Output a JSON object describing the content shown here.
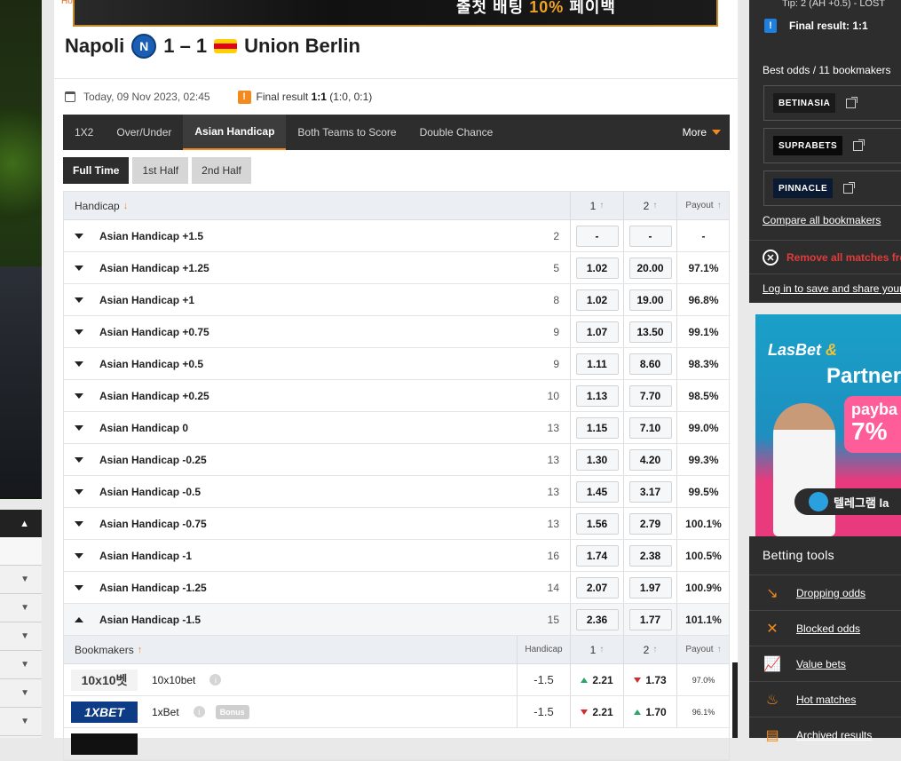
{
  "left_panel": {
    "rows": 6
  },
  "banner": {
    "text": "출첫 배팅",
    "highlight": "10%",
    "suffix": "페이백",
    "breadcrumb": "Ho"
  },
  "match": {
    "home": "Napoli",
    "home_crest": "N",
    "score": "1 – 1",
    "away": "Union Berlin",
    "date": "Today, 09 Nov 2023, 02:45",
    "final_label": "Final result",
    "final_score": "1:1",
    "final_detail": "(1:0, 0:1)"
  },
  "market_tabs": {
    "items": [
      {
        "label": "1X2",
        "active": false
      },
      {
        "label": "Over/Under",
        "active": false
      },
      {
        "label": "Asian Handicap",
        "active": true
      },
      {
        "label": "Both Teams to Score",
        "active": false
      },
      {
        "label": "Double Chance",
        "active": false
      }
    ],
    "more_label": "More"
  },
  "period_tabs": [
    {
      "label": "Full Time",
      "active": true
    },
    {
      "label": "1st Half",
      "active": false
    },
    {
      "label": "2nd Half",
      "active": false
    }
  ],
  "table": {
    "header": {
      "handicap": "Handicap",
      "col1": "1",
      "col2": "2",
      "payout": "Payout"
    },
    "rows": [
      {
        "label": "Asian Handicap +1.5",
        "count": "2",
        "o1": "-",
        "o2": "-",
        "payout": "-"
      },
      {
        "label": "Asian Handicap +1.25",
        "count": "5",
        "o1": "1.02",
        "o2": "20.00",
        "payout": "97.1%"
      },
      {
        "label": "Asian Handicap +1",
        "count": "8",
        "o1": "1.02",
        "o2": "19.00",
        "payout": "96.8%"
      },
      {
        "label": "Asian Handicap +0.75",
        "count": "9",
        "o1": "1.07",
        "o2": "13.50",
        "payout": "99.1%"
      },
      {
        "label": "Asian Handicap +0.5",
        "count": "9",
        "o1": "1.11",
        "o2": "8.60",
        "payout": "98.3%"
      },
      {
        "label": "Asian Handicap +0.25",
        "count": "10",
        "o1": "1.13",
        "o2": "7.70",
        "payout": "98.5%"
      },
      {
        "label": "Asian Handicap 0",
        "count": "13",
        "o1": "1.15",
        "o2": "7.10",
        "payout": "99.0%"
      },
      {
        "label": "Asian Handicap -0.25",
        "count": "13",
        "o1": "1.30",
        "o2": "4.20",
        "payout": "99.3%"
      },
      {
        "label": "Asian Handicap -0.5",
        "count": "13",
        "o1": "1.45",
        "o2": "3.17",
        "payout": "99.5%"
      },
      {
        "label": "Asian Handicap -0.75",
        "count": "13",
        "o1": "1.56",
        "o2": "2.79",
        "payout": "100.1%"
      },
      {
        "label": "Asian Handicap -1",
        "count": "16",
        "o1": "1.74",
        "o2": "2.38",
        "payout": "100.5%"
      },
      {
        "label": "Asian Handicap -1.25",
        "count": "14",
        "o1": "2.07",
        "o2": "1.97",
        "payout": "100.9%"
      },
      {
        "label": "Asian Handicap -1.5",
        "count": "15",
        "o1": "2.36",
        "o2": "1.77",
        "payout": "101.1%",
        "expanded": true
      }
    ],
    "bookmakers_header": {
      "name": "Bookmakers",
      "handicap": "Handicap",
      "col1": "1",
      "col2": "2",
      "payout": "Payout"
    },
    "bookmakers": [
      {
        "logo_text": "10x10벳",
        "name": "10x10bet",
        "handicap": "-1.5",
        "o1": "2.21",
        "o1_trend": "up",
        "o2": "1.73",
        "o2_trend": "down",
        "payout": "97.0%",
        "bonus": ""
      },
      {
        "logo_text": "1XBET",
        "name": "1xBet",
        "handicap": "-1.5",
        "o1": "2.21",
        "o1_trend": "down",
        "o2": "1.70",
        "o2_trend": "up",
        "payout": "96.1%",
        "bonus": "Bonus"
      }
    ]
  },
  "sidebar": {
    "tip": "Tip: 2 (AH +0.5) - LOST",
    "final_result": "Final result: 1:1",
    "best_odds_title": "Best odds / 11 bookmakers",
    "bookmakers": [
      "BETINASIA",
      "SUPRABETS",
      "PINNACLE"
    ],
    "compare": "Compare all bookmakers",
    "remove": "Remove all matches from",
    "login": "Log in to save and share your",
    "ad": {
      "brand": "LasBet",
      "amp": "&",
      "partner": "Partner",
      "pill_top": "payba",
      "pill_big": "7%",
      "tg": "텔레그램 la"
    },
    "tools_title": "Betting tools",
    "tools": [
      {
        "label": "Dropping odds",
        "icon": "dropping-odds-icon"
      },
      {
        "label": "Blocked odds",
        "icon": "blocked-odds-icon"
      },
      {
        "label": "Value bets",
        "icon": "value-bets-icon"
      },
      {
        "label": "Hot matches",
        "icon": "hot-matches-icon"
      },
      {
        "label": "Archived results",
        "icon": "archived-results-icon"
      }
    ]
  },
  "colors": {
    "accent": "#f28a1d",
    "dark": "#2d2d2d",
    "up": "#2aa568",
    "down": "#d62a2a"
  }
}
